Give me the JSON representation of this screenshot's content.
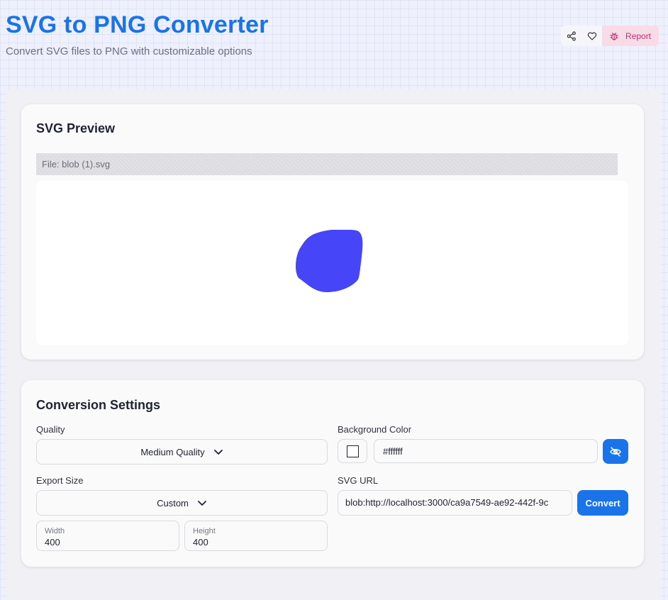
{
  "header": {
    "title": "SVG to PNG Converter",
    "subtitle": "Convert SVG files to PNG with customizable options",
    "report_label": "Report"
  },
  "preview": {
    "title": "SVG Preview",
    "file_label": "File: blob (1).svg",
    "blob_color": "#4646f8"
  },
  "settings": {
    "title": "Conversion Settings",
    "quality": {
      "label": "Quality",
      "value": "Medium Quality"
    },
    "export_size": {
      "label": "Export Size",
      "value": "Custom"
    },
    "width": {
      "label": "Width",
      "value": "400"
    },
    "height": {
      "label": "Height",
      "value": "400"
    },
    "background": {
      "label": "Background Color",
      "value": "#ffffff"
    },
    "svg_url": {
      "label": "SVG URL",
      "value": "blob:http://localhost:3000/ca9a7549-ae92-442f-9c"
    },
    "convert_label": "Convert"
  },
  "colors": {
    "accent": "#1a73e8",
    "report_bg": "#f9dbe8",
    "report_text": "#c0306f"
  },
  "icons": [
    "share-icon",
    "heart-icon",
    "bug-icon",
    "chevron-down-icon",
    "eye-off-icon"
  ]
}
